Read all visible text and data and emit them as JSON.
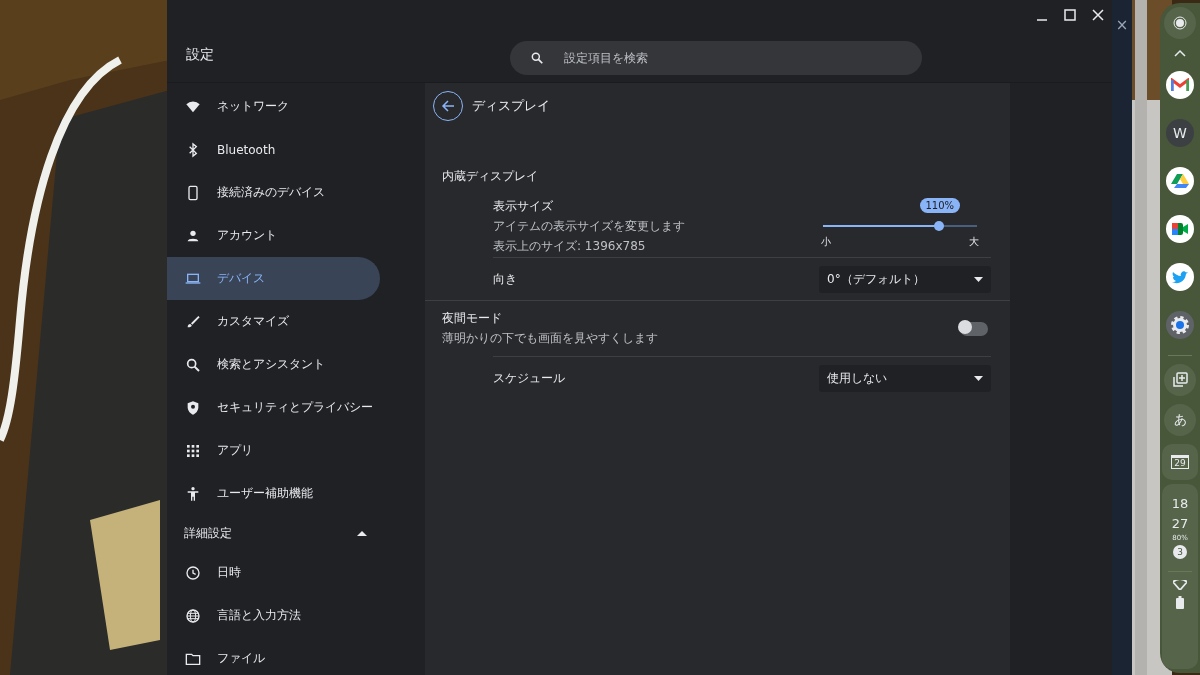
{
  "window": {
    "title": "設定",
    "search": {
      "placeholder": "設定項目を検索"
    }
  },
  "sidebar": {
    "items": [
      {
        "label": "ネットワーク",
        "selected": false
      },
      {
        "label": "Bluetooth",
        "selected": false
      },
      {
        "label": "接続済みのデバイス",
        "selected": false
      },
      {
        "label": "アカウント",
        "selected": false
      },
      {
        "label": "デバイス",
        "selected": true
      },
      {
        "label": "カスタマイズ",
        "selected": false
      },
      {
        "label": "検索とアシスタント",
        "selected": false
      },
      {
        "label": "セキュリティとプライバシー",
        "selected": false
      },
      {
        "label": "アプリ",
        "selected": false
      },
      {
        "label": "ユーザー補助機能",
        "selected": false
      }
    ],
    "advanced": {
      "label": "詳細設定",
      "expanded": true,
      "items": [
        {
          "label": "日時",
          "selected": false
        },
        {
          "label": "言語と入力方法",
          "selected": false
        },
        {
          "label": "ファイル",
          "selected": false
        }
      ]
    }
  },
  "page": {
    "title": "ディスプレイ",
    "section": "内蔵ディスプレイ",
    "display_size": {
      "label": "表示サイズ",
      "description": "アイテムの表示サイズを変更します",
      "resolution": "表示上のサイズ: 1396x785",
      "value_badge": "110%",
      "level": 0.75,
      "min_label": "小",
      "max_label": "大"
    },
    "orientation": {
      "label": "向き",
      "value": "0°（デフォルト）"
    },
    "night_mode": {
      "label": "夜間モード",
      "description": "薄明かりの下でも画面を見やすくします",
      "on": false
    },
    "schedule": {
      "label": "スケジュール",
      "value": "使用しない"
    }
  },
  "background_window": {
    "close": "×"
  },
  "shelf": {
    "apps": [
      {
        "kind": "gmail"
      },
      {
        "kind": "letter",
        "label": "W"
      },
      {
        "kind": "drive"
      },
      {
        "kind": "meet"
      },
      {
        "kind": "twitter"
      },
      {
        "kind": "settings"
      }
    ],
    "ime": "あ",
    "calendar_day": "29",
    "time": [
      "18",
      "27"
    ],
    "weather": "80%",
    "notifications": "3"
  }
}
